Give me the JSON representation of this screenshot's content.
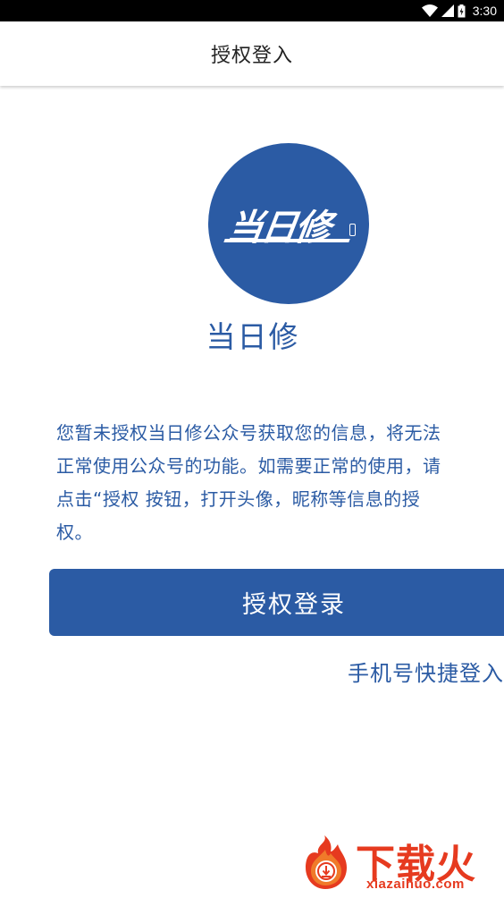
{
  "status_bar": {
    "time": "3:30",
    "icons": [
      "wifi-icon",
      "cellular-signal-icon",
      "battery-icon"
    ]
  },
  "nav": {
    "title": "授权登入"
  },
  "logo": {
    "text": "当日修",
    "icon": "phone-icon",
    "color": "#2b5ba4"
  },
  "app": {
    "name": "当日修"
  },
  "message": {
    "text": "您暂未授权当日修公众号获取您的信息，将无法正常使用公众号的功能。如需要正常的使用，请点击“授权 按钮，打开头像，昵称等信息的授权。"
  },
  "auth_button": {
    "label": "授权登录"
  },
  "phone_login": {
    "label": "手机号快捷登入"
  },
  "watermark": {
    "text": "下载火",
    "domain": "xiazaihuo.com",
    "icon": "flame-download-icon",
    "color": "#e63a1f"
  },
  "colors": {
    "primary": "#2b5ba4",
    "status_bar": "#000000",
    "background": "#ffffff"
  }
}
